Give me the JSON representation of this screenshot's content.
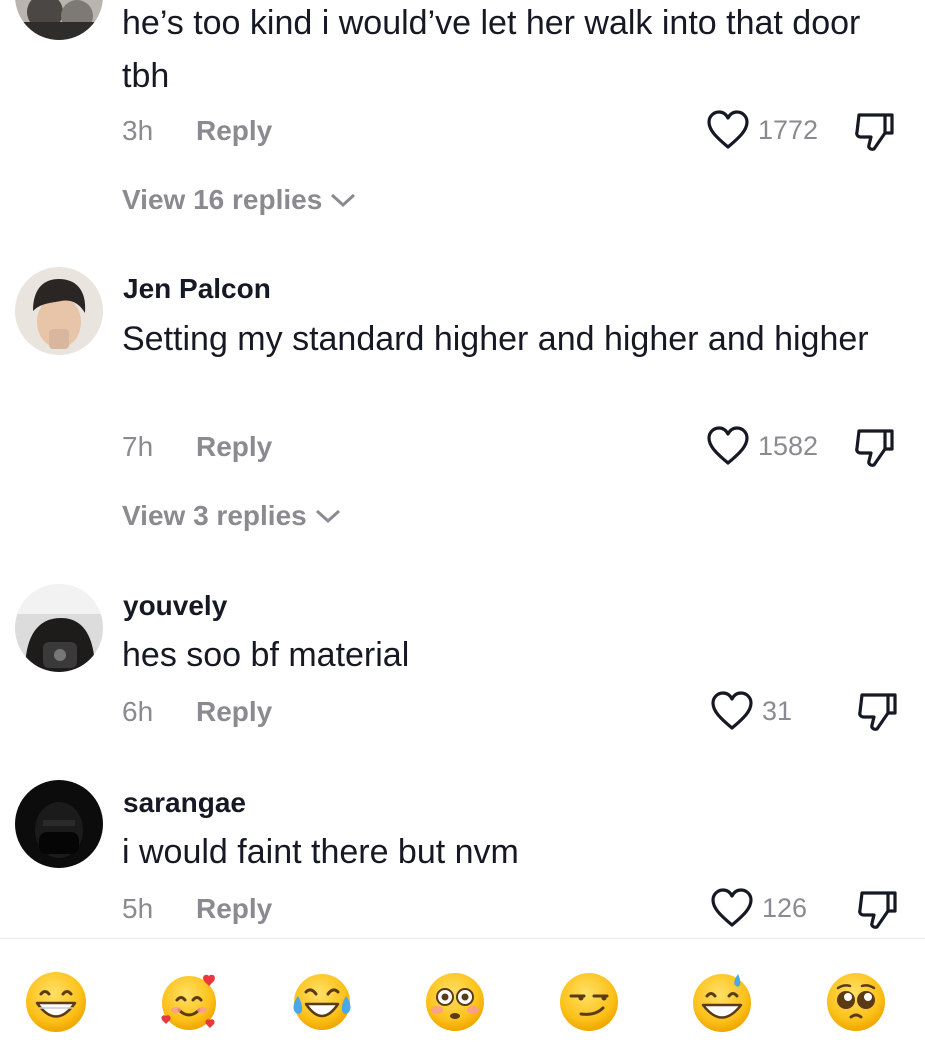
{
  "comments": [
    {
      "username": "",
      "text": "he’s too kind i would’ve let her walk into that door tbh",
      "time": "3h",
      "reply_label": "Reply",
      "likes": "1772",
      "view_replies": "View 16 replies"
    },
    {
      "username": "Jen Palcon",
      "text": "Setting my standard higher and higher and higher",
      "time": "7h",
      "reply_label": "Reply",
      "likes": "1582",
      "view_replies": "View 3 replies"
    },
    {
      "username": "youvely",
      "text": "hes soo bf material",
      "time": "6h",
      "reply_label": "Reply",
      "likes": "31"
    },
    {
      "username": "sarangae",
      "text": "i would faint there but nvm",
      "time": "5h",
      "reply_label": "Reply",
      "likes": "126"
    }
  ],
  "emoji_bar": [
    "grinning-face-emoji",
    "smiling-face-with-hearts-emoji",
    "face-with-tears-of-joy-emoji",
    "flushed-face-emoji",
    "smirking-face-emoji",
    "grinning-face-with-sweat-emoji",
    "pleading-face-emoji"
  ],
  "colors": {
    "text": "#161823",
    "muted": "#8a8b91",
    "emoji_yellow": "#fcc21b"
  }
}
